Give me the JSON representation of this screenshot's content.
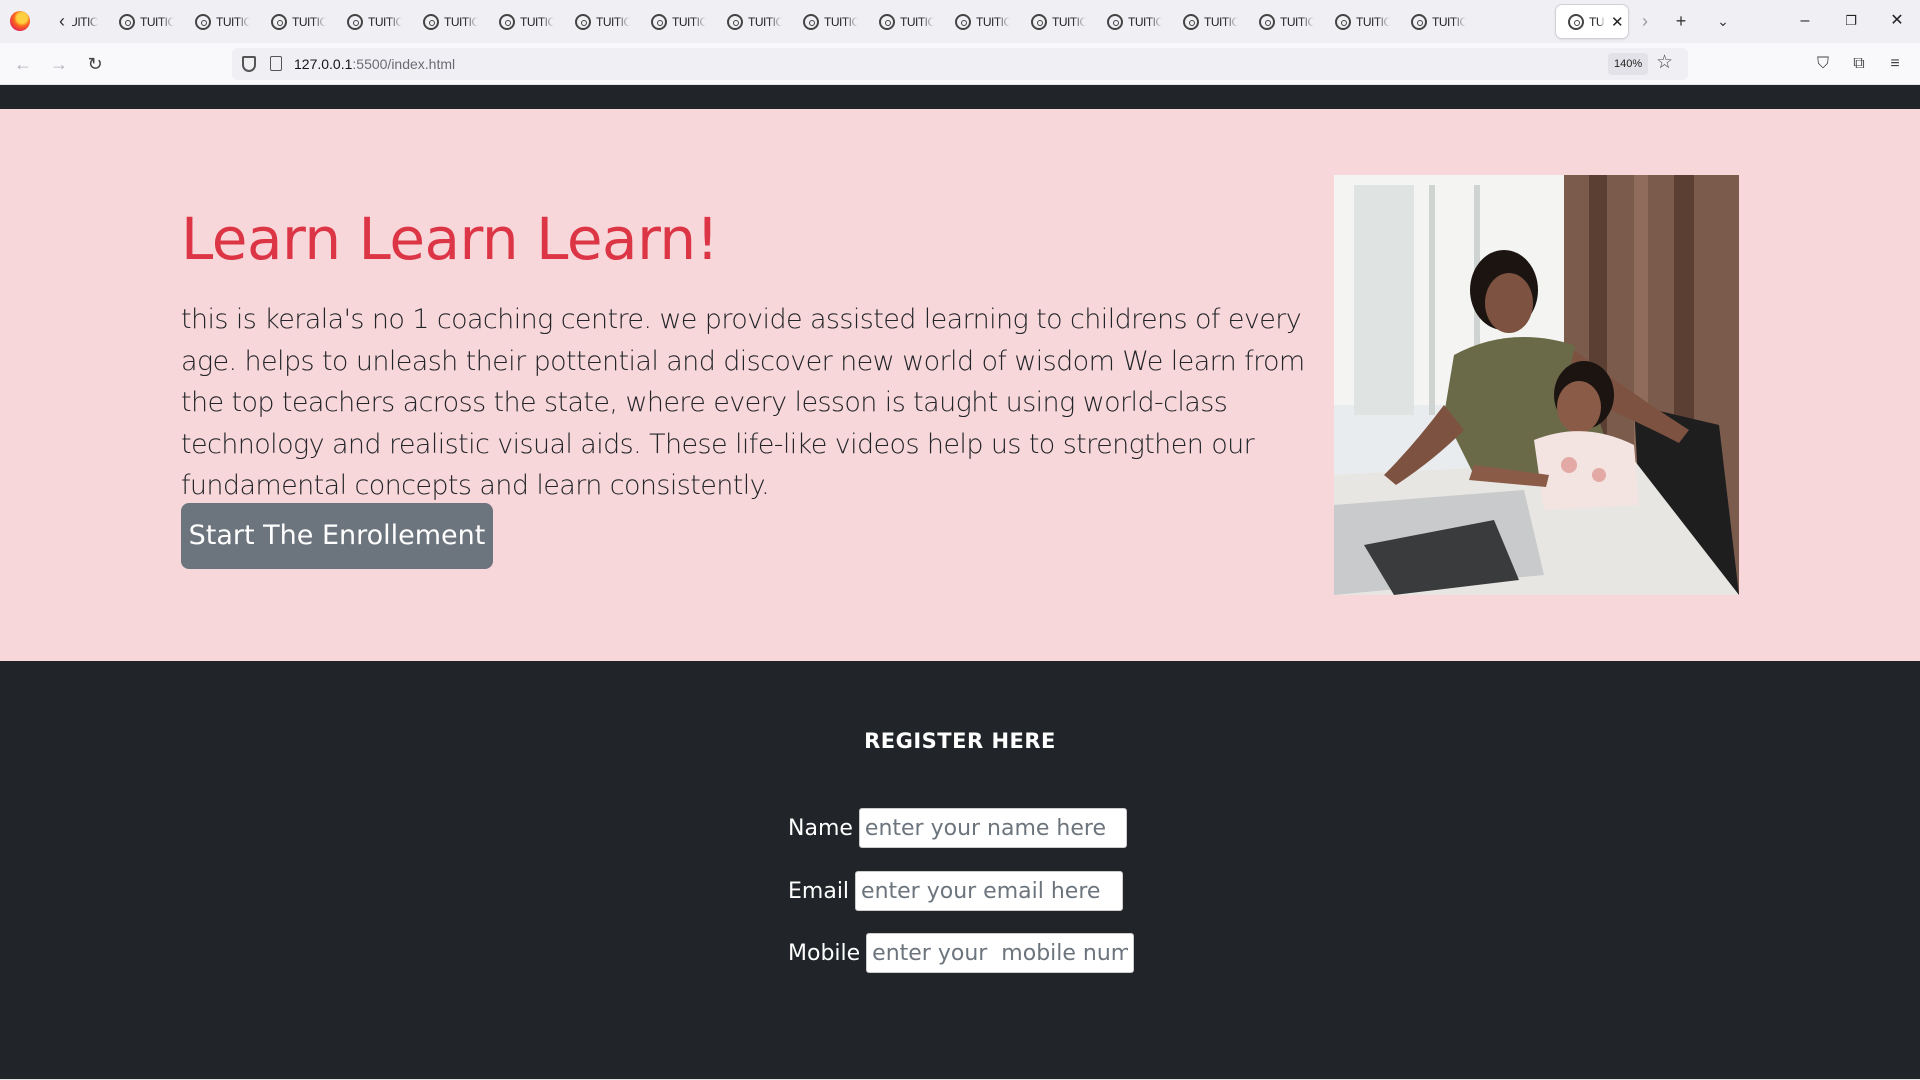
{
  "browser": {
    "tab_label": "TUITIC",
    "active_tab_label": "TU",
    "tab_count": 19,
    "url_host": "127.0.0.1",
    "url_rest": ":5500/index.html",
    "zoom": "140%"
  },
  "hero": {
    "title": "Learn Learn Learn!",
    "text": "this is kerala's no 1 coaching centre. we provide assisted learning to childrens of every age. helps to unleash their pottential and discover new world of wisdom We learn from the top teachers across the state, where every lesson is taught using world-class technology and realistic visual aids. These life-like videos help us to strengthen our fundamental concepts and learn consistently.",
    "button": "Start The Enrollement"
  },
  "register": {
    "title": "REGISTER HERE",
    "name_label": "Name",
    "name_placeholder": "enter your name here",
    "email_label": "Email",
    "email_placeholder": "enter your email here",
    "mobile_label": "Mobile",
    "mobile_placeholder": "enter your  mobile number"
  },
  "colors": {
    "hero_bg": "#f8d7da",
    "title_red": "#dc3545",
    "dark_bg": "#212529",
    "button_gray": "#6c757d"
  }
}
